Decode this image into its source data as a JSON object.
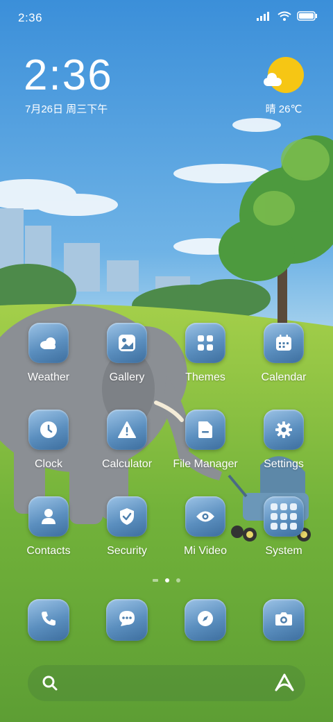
{
  "status_bar": {
    "time": "2:36"
  },
  "lock_widget": {
    "time": "2:36",
    "date": "7月26日 周三下午"
  },
  "weather_widget": {
    "text": "晴 26℃",
    "icon": "sun-cloud-icon"
  },
  "apps": [
    {
      "label": "Weather",
      "icon": "cloud-icon"
    },
    {
      "label": "Gallery",
      "icon": "image-icon"
    },
    {
      "label": "Themes",
      "icon": "grid-icon"
    },
    {
      "label": "Calendar",
      "icon": "calendar-icon"
    },
    {
      "label": "Clock",
      "icon": "clock-icon"
    },
    {
      "label": "Calculator",
      "icon": "warning-icon"
    },
    {
      "label": "File Manager",
      "icon": "folder-icon"
    },
    {
      "label": "Settings",
      "icon": "gear-icon"
    },
    {
      "label": "Contacts",
      "icon": "person-icon"
    },
    {
      "label": "Security",
      "icon": "shield-icon"
    },
    {
      "label": "Mi Video",
      "icon": "eye-icon"
    },
    {
      "label": "System",
      "icon": "folder-grid-icon"
    }
  ],
  "dock": [
    {
      "icon": "phone-icon"
    },
    {
      "icon": "message-icon"
    },
    {
      "icon": "compass-icon"
    },
    {
      "icon": "camera-icon"
    }
  ],
  "page_indicator": {
    "pages": 3,
    "current": 2
  },
  "colors": {
    "tile": "#5b8fbf",
    "sun": "#f6c614",
    "grass": "#7fb83a",
    "sky": "#4a9ee0"
  }
}
